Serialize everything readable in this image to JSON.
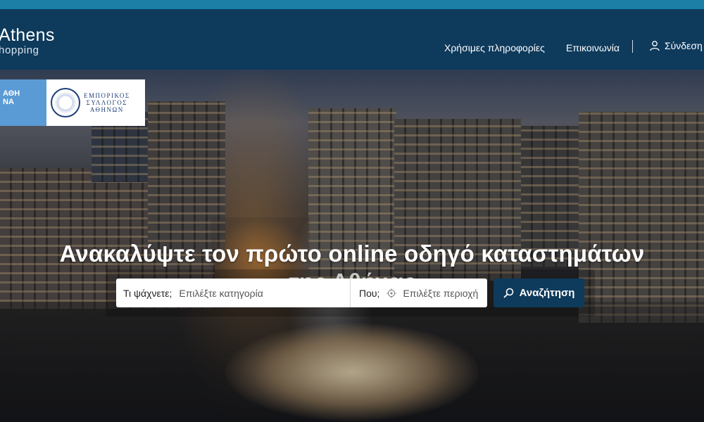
{
  "brand": {
    "line1": "Athens",
    "line2": "hopping"
  },
  "nav": {
    "useful_info": "Χρήσιμες πληροφορίες",
    "contact": "Επικοινωνία",
    "login": "Σύνδεση"
  },
  "logos": {
    "athina_text": "ΑΘΗ\nΝΑ",
    "esa_text": "ΕΜΠΟΡΙΚΟΣ\nΣΥΛΛΟΓΟΣ\nΑΘΗΝΩΝ"
  },
  "hero": {
    "headline_line1": "Ανακαλύψτε τον πρώτο online οδηγό καταστημάτων",
    "headline_line2": "της Αθήνας"
  },
  "search": {
    "what_label": "Τι ψάχνετε;",
    "what_value": "Επιλέξτε κατηγορία",
    "where_label": "Που;",
    "where_value": "Επιλέξτε περιοχή",
    "button_label": "Αναζήτηση"
  },
  "icons": {
    "user": "user-icon",
    "location": "location-icon",
    "search": "search-icon"
  },
  "colors": {
    "header_bg": "#0e3a5c",
    "top_strip": "#1b7fa6",
    "button_bg": "#0e3a5c",
    "athina_blue": "#5b9bd5"
  }
}
